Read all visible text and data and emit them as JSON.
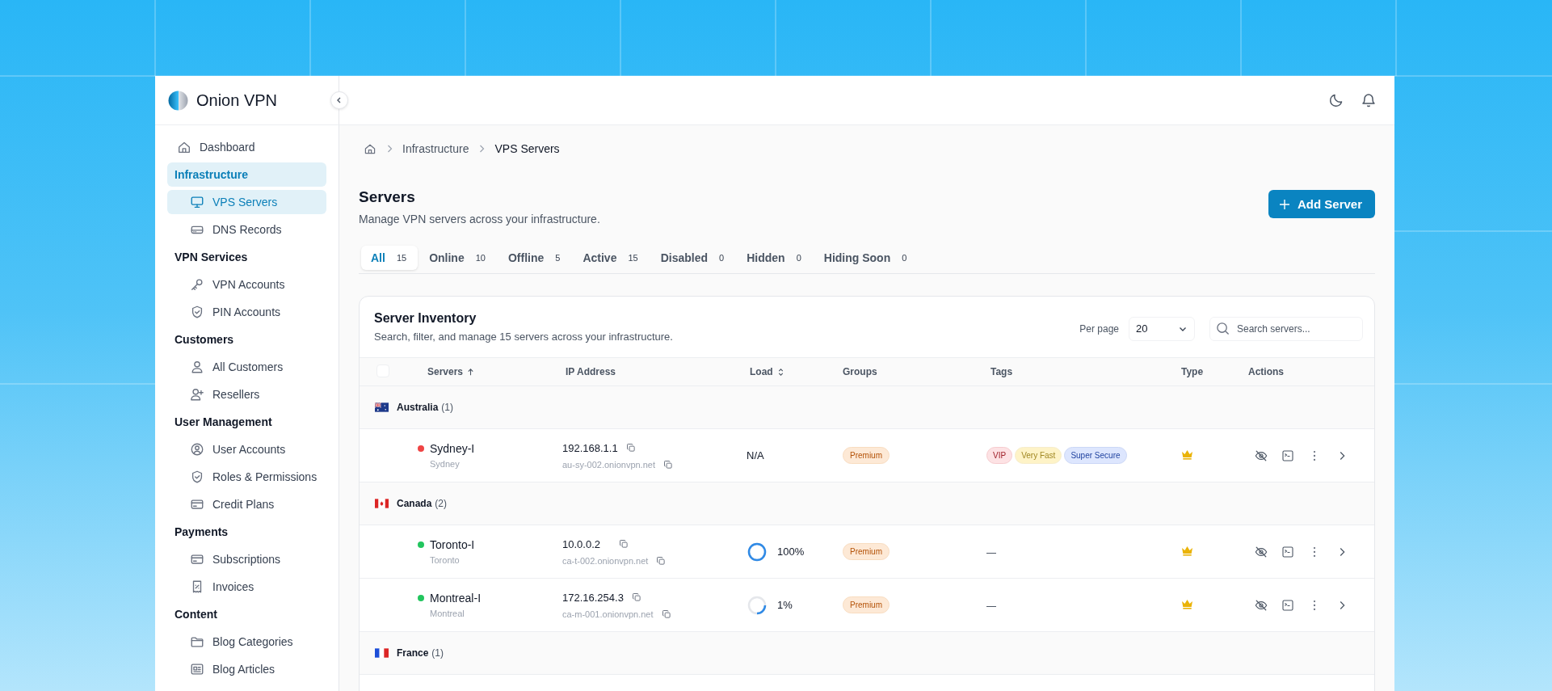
{
  "sidebar": {
    "brand": "Onion VPN",
    "items": [
      {
        "label": "Dashboard",
        "selected": false
      },
      {
        "label": "Infrastructure",
        "selected": true,
        "children": [
          {
            "label": "VPS Servers",
            "selected": true
          },
          {
            "label": "DNS Records",
            "selected": false
          }
        ]
      },
      {
        "label": "VPN Services",
        "selected": false,
        "children": [
          {
            "label": "VPN Accounts",
            "selected": false
          },
          {
            "label": "PIN Accounts",
            "selected": false
          }
        ]
      },
      {
        "label": "Customers",
        "selected": false,
        "children": [
          {
            "label": "All Customers",
            "selected": false
          },
          {
            "label": "Resellers",
            "selected": false
          }
        ]
      },
      {
        "label": "User Management",
        "selected": false,
        "children": [
          {
            "label": "User Accounts",
            "selected": false
          },
          {
            "label": "Roles & Permissions",
            "selected": false
          },
          {
            "label": "Credit Plans",
            "selected": false
          }
        ]
      },
      {
        "label": "Payments",
        "selected": false,
        "children": [
          {
            "label": "Subscriptions",
            "selected": false
          },
          {
            "label": "Invoices",
            "selected": false
          }
        ]
      },
      {
        "label": "Content",
        "selected": false,
        "children": [
          {
            "label": "Blog Categories",
            "selected": false
          },
          {
            "label": "Blog Articles",
            "selected": false
          }
        ]
      }
    ]
  },
  "breadcrumb": [
    "Infrastructure",
    "VPS Servers"
  ],
  "page": {
    "title": "Servers",
    "subtitle": "Manage VPN servers across your infrastructure.",
    "action": "Add Server"
  },
  "tabs": [
    {
      "label": "All",
      "count": "15",
      "selected": true
    },
    {
      "label": "Online",
      "count": "10",
      "selected": false
    },
    {
      "label": "Offline",
      "count": "5",
      "selected": false
    },
    {
      "label": "Active",
      "count": "15",
      "selected": false
    },
    {
      "label": "Disabled",
      "count": "0",
      "selected": false
    },
    {
      "label": "Hidden",
      "count": "0",
      "selected": false
    },
    {
      "label": "Hiding Soon",
      "count": "0",
      "selected": false
    }
  ],
  "card": {
    "title": "Server Inventory",
    "subtitle": "Search, filter, and manage 15 servers across your infrastructure.",
    "per_page_label": "Per page",
    "per_page": "20",
    "search_placeholder": "Search servers..."
  },
  "table": {
    "select_all": {
      "checked": false
    },
    "columns": [
      {
        "label": "Servers",
        "sorted_ascending": true
      },
      {
        "label": "IP Address"
      },
      {
        "label": "Load",
        "sortable": true
      },
      {
        "label": "Groups"
      },
      {
        "label": "Tags"
      },
      {
        "label": "Type"
      },
      {
        "label": "Actions"
      }
    ],
    "groups": [
      {
        "country": "Australia",
        "count": "(1)",
        "servers": [
          {
            "name": "Sydney-I",
            "city": "Sydney",
            "color": "#ef4444",
            "ip": "192.168.1.1",
            "hostname": "au-sy-002.onionvpn.net",
            "load_reading": "N/A",
            "group": "Premium",
            "tags": [
              {
                "label": "VIP",
                "color": "#fde2e4"
              },
              {
                "label": "Very Fast",
                "color": "#fef3c7"
              },
              {
                "label": "Super Secure",
                "color": "#dde6fe"
              }
            ],
            "premium": true
          }
        ]
      },
      {
        "country": "Canada",
        "count": "(2)",
        "servers": [
          {
            "name": "Toronto-I",
            "city": "Toronto",
            "color": "#22c55e",
            "ip": "10.0.0.2",
            "hostname": "ca-t-002.onionvpn.net",
            "load": {
              "level": 1,
              "reading": "100%"
            },
            "group": "Premium",
            "tags_placeholder": "—",
            "premium": true
          },
          {
            "name": "Montreal-I",
            "city": "Montreal",
            "color": "#22c55e",
            "ip": "172.16.254.3",
            "hostname": "ca-m-001.onionvpn.net",
            "load": {
              "level": 0.25,
              "reading": "1%"
            },
            "group": "Premium",
            "tags_placeholder": "—",
            "premium": true
          }
        ]
      },
      {
        "country": "France",
        "count": "(1)"
      }
    ]
  }
}
